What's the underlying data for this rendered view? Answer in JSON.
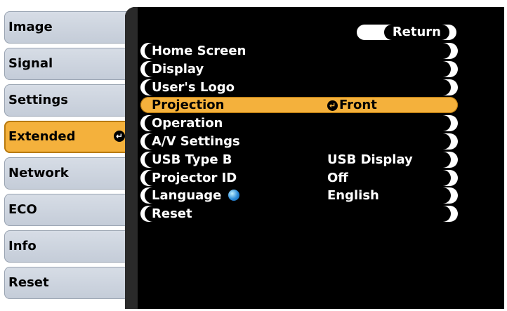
{
  "tabs": [
    {
      "label": "Image",
      "active": false
    },
    {
      "label": "Signal",
      "active": false
    },
    {
      "label": "Settings",
      "active": false
    },
    {
      "label": "Extended",
      "active": true
    },
    {
      "label": "Network",
      "active": false
    },
    {
      "label": "ECO",
      "active": false
    },
    {
      "label": "Info",
      "active": false
    },
    {
      "label": "Reset",
      "active": false
    }
  ],
  "return_label": "Return",
  "rows": [
    {
      "label": "Home Screen",
      "value": ""
    },
    {
      "label": "Display",
      "value": ""
    },
    {
      "label": "User's Logo",
      "value": ""
    },
    {
      "label": "Projection",
      "value": "Front"
    },
    {
      "label": "Operation",
      "value": ""
    },
    {
      "label": "A/V Settings",
      "value": ""
    },
    {
      "label": "USB Type B",
      "value": "USB Display"
    },
    {
      "label": "Projector ID",
      "value": "Off"
    },
    {
      "label": "Language",
      "value": "English"
    },
    {
      "label": "Reset",
      "value": ""
    }
  ],
  "icons": {
    "enter": "enter-icon",
    "language": "globe-icon"
  },
  "colors": {
    "highlight": "#f4b13c",
    "panel": "#000000",
    "tab": "#c9d0da"
  }
}
